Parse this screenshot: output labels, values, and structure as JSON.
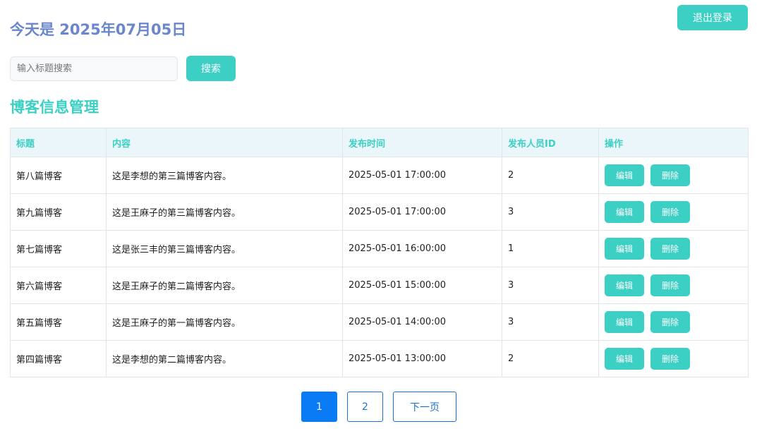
{
  "header": {
    "date_text": "今天是 2025年07月05日",
    "logout_label": "退出登录"
  },
  "search": {
    "placeholder": "输入标题搜索",
    "value": "",
    "button_label": "搜索"
  },
  "section": {
    "title": "博客信息管理"
  },
  "table": {
    "columns": [
      "标题",
      "内容",
      "发布时间",
      "发布人员ID",
      "操作"
    ],
    "rows": [
      {
        "title": "第八篇博客",
        "content": "这是李想的第三篇博客内容。",
        "time": "2025-05-01 17:00:00",
        "user_id": "2"
      },
      {
        "title": "第九篇博客",
        "content": "这是王麻子的第三篇博客内容。",
        "time": "2025-05-01 17:00:00",
        "user_id": "3"
      },
      {
        "title": "第七篇博客",
        "content": "这是张三丰的第三篇博客内容。",
        "time": "2025-05-01 16:00:00",
        "user_id": "1"
      },
      {
        "title": "第六篇博客",
        "content": "这是王麻子的第二篇博客内容。",
        "time": "2025-05-01 15:00:00",
        "user_id": "3"
      },
      {
        "title": "第五篇博客",
        "content": "这是王麻子的第一篇博客内容。",
        "time": "2025-05-01 14:00:00",
        "user_id": "3"
      },
      {
        "title": "第四篇博客",
        "content": "这是李想的第二篇博客内容。",
        "time": "2025-05-01 13:00:00",
        "user_id": "2"
      }
    ],
    "edit_label": "编辑",
    "delete_label": "删除"
  },
  "pagination": {
    "pages": [
      "1",
      "2"
    ],
    "current": "1",
    "next_label": "下一页"
  },
  "colors": {
    "accent": "#3ccfc4",
    "header_text": "#6a86cc",
    "page_active": "#0a7bf5",
    "page_border": "#1a6fd8"
  }
}
